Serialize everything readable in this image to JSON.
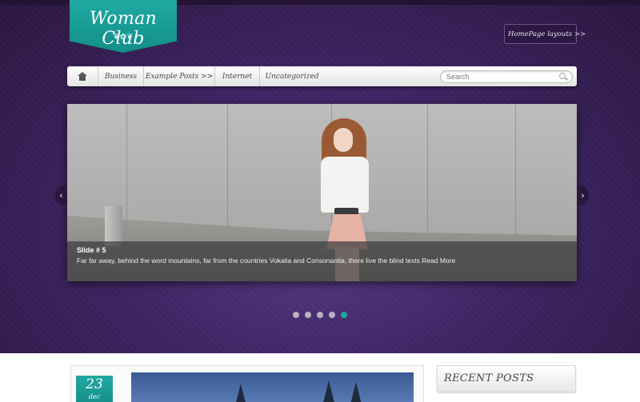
{
  "logo": {
    "title": "Woman Club",
    "ornament": "❦✿❦"
  },
  "toplinks": {
    "home": "Home",
    "page_layouts": "Page layouts >>"
  },
  "nav": {
    "items": [
      {
        "label": "Business"
      },
      {
        "label": "Example Posts >>"
      },
      {
        "label": "Internet"
      },
      {
        "label": "Uncategorized"
      }
    ]
  },
  "search": {
    "placeholder": "Search"
  },
  "slider": {
    "caption_title": "Slide # 5",
    "caption_text": "Far far away, behind the word mountains, far from the countries Vokalia and Consonantia, there live the blind texts Read More",
    "prev_glyph": "‹",
    "next_glyph": "›",
    "total_slides": 5,
    "active_slide": 5
  },
  "post": {
    "day": "23",
    "month": "dec"
  },
  "sidebar": {
    "recent_posts_title": "RECENT POSTS"
  },
  "colors": {
    "accent": "#1fa9a2",
    "background": "#3e2463"
  }
}
